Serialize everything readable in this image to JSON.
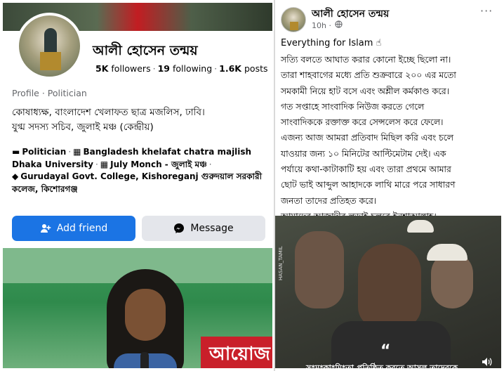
{
  "profile": {
    "name": "আলী হোসেন তন্ময়",
    "followers": "5K",
    "followers_label": "followers",
    "following": "19",
    "following_label": "following",
    "posts": "1.6K",
    "posts_label": "posts",
    "profile_label": "Profile · Politician",
    "bio_line1": "কোষাধ্যক্ষ, বাংলাদেশ খেলাফত ছাত্র মজলিস, ঢাবি।",
    "bio_line2": "যুগ্ম সদস্য সচিব, জুলাই মঞ্চ (কেন্দ্রীয়)",
    "detail_politician": "Politician",
    "detail_work1": "Bangladesh khelafat chatra majlish Dhaka University",
    "detail_work2": "July Monch - জুলাই মঞ্চ",
    "detail_school": "Gurudayal Govt. College, Kishoreganj গুরুদয়াল সরকারী কলেজ, কিশোরগঞ্জ",
    "add_friend_label": "Add friend",
    "message_label": "Message",
    "photo_sign_text": "আয়োজ"
  },
  "post": {
    "author": "আলী হোসেন তন্ময়",
    "time": "10h",
    "more": "···",
    "title": "Everything for Islam ☝",
    "lines": [
      "সত্যি বলতে আঘাত করার কোনো ইচ্ছে ছিলো না।",
      "তারা শাহবাগের মধ্যে প্রতি শুক্রবারে ২০০ এর মতো",
      "সমকামী নিয়ে হাট বসে এবং অশ্লীল কর্মকাণ্ড করে।",
      "গত সপ্তাহে সাংবাদিক নিউজ করতে গেলে",
      "সাংবাদিককে রক্তাক্ত করে সেন্সলেস করে ফেলে।",
      "এজন্য আজ আমরা প্রতিবাদ মিছিল করি এবং চলে",
      "যাওয়ার জন্য ১০ মিনিটের আল্টিমেটাম দেই। এক",
      "পর্যায়ে কথা-কাটাকাটি হয় এবং তারা প্রথমে আমার",
      "ছোট ভাই আব্দুল আহাদকে লাথি মারে পরে সাধারণ",
      "জনতা তাদের প্রতিহত করে।",
      "আমাদের আজাদীর লড়াই চলবে ইনশাআল্লাহ।"
    ],
    "video_watermark": "HASAN_TAMIL",
    "video_subtitle": "স*ম*কা*মি*তা প্রতিষ্ঠিত করতে আসল তাদেরকে"
  },
  "colors": {
    "primary": "#1b74e4",
    "secondary_button": "#e4e6eb",
    "muted_text": "#65676b"
  },
  "icons": [
    "user-plus-icon",
    "messenger-icon",
    "briefcase-icon",
    "building-icon",
    "graduation-cap-icon",
    "globe-icon",
    "speaker-icon"
  ]
}
